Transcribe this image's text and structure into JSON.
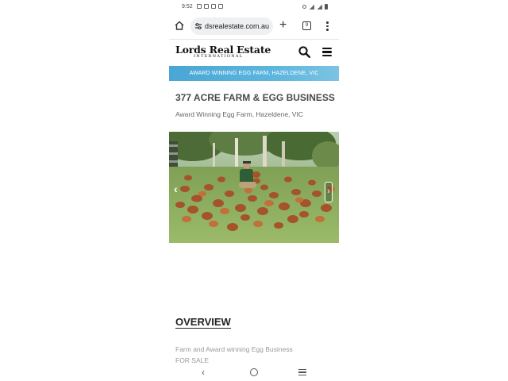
{
  "status_bar": {
    "time": "9:52"
  },
  "browser": {
    "url": "dsrealestate.com.au",
    "tab_count": "9",
    "plus_glyph": "+"
  },
  "site": {
    "logo_main": "Lords Real Estate",
    "logo_sub": "INTERNATIONAL"
  },
  "banner": "AWARD WINNING EGG FARM, HAZELDENE, VIC",
  "listing": {
    "title": "377 ACRE FARM & EGG BUSINESS",
    "subtitle": "Award Winning Egg Farm, Hazeldene, VIC"
  },
  "gallery": {
    "prev_glyph": "‹",
    "next_glyph": "›"
  },
  "overview": {
    "heading": "OVERVIEW",
    "line1": "Farm and Award winning Egg Business",
    "line2": "FOR SALE"
  },
  "nav": {
    "back_glyph": "‹"
  },
  "colors": {
    "banner": "#5bb5de",
    "text_dark": "#222222",
    "text_muted": "#9a9a9a"
  }
}
